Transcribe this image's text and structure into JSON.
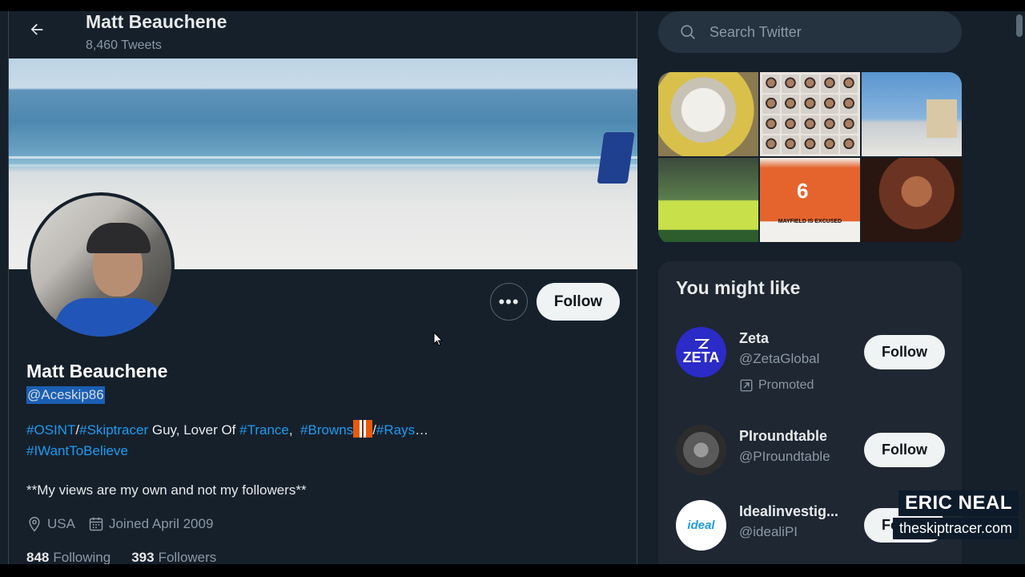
{
  "header": {
    "title": "Matt Beauchene",
    "tweet_count": "8,460 Tweets"
  },
  "profile": {
    "name": "Matt Beauchene",
    "handle": "@Aceskip86",
    "follow_label": "Follow",
    "more_label": "•••",
    "bio": {
      "tag1": "#OSINT",
      "sep1": "/",
      "tag2": "#Skiptracer",
      "text1": " Guy, Lover Of ",
      "tag3": "#Trance",
      "text2": ",  ",
      "tag4": "#Browns",
      "sep2": "/",
      "tag5": "#Rays",
      "ellipsis": "…",
      "tag6": "#IWantToBelieve"
    },
    "bio_line2": "**My views are my own and not my followers**",
    "location": "USA",
    "joined": "Joined April 2009",
    "following_count": "848",
    "following_label": "Following",
    "followers_count": "393",
    "followers_label": "Followers"
  },
  "search": {
    "placeholder": "Search Twitter"
  },
  "media_tiles": {
    "mayfield_caption": "MAYFIELD IS EXCUSED",
    "mayfield_number": "6"
  },
  "you_might_like": {
    "title": "You might like",
    "items": [
      {
        "name": "Zeta",
        "handle": "@ZetaGlobal",
        "promoted": "Promoted",
        "avatar_text": "ZETA",
        "follow": "Follow"
      },
      {
        "name": "PIroundtable",
        "handle": "@PIroundtable",
        "follow": "Follow"
      },
      {
        "name": "Idealinvestig...",
        "handle": "@idealiPI",
        "avatar_text": "ideal",
        "follow": "Follow"
      }
    ]
  },
  "watermark": {
    "name": "ERIC NEAL",
    "url": "theskiptracer.com"
  },
  "colors": {
    "background": "#15202b",
    "link": "#1d9bf0",
    "secondary_text": "#8b98a5",
    "button_bg": "#eff3f4"
  }
}
